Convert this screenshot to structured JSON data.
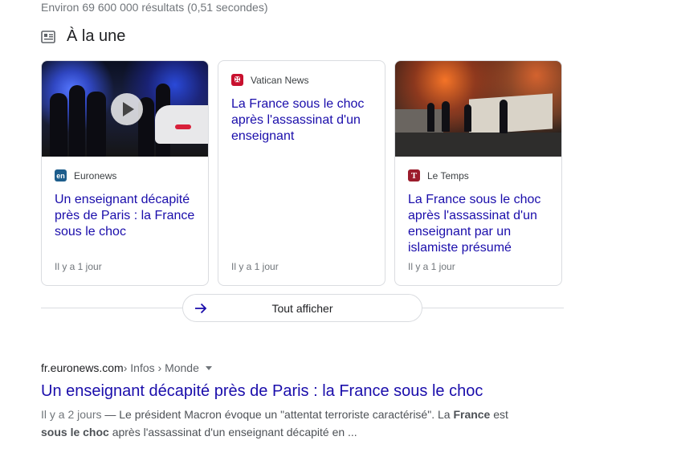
{
  "result_stats": "Environ 69 600 000 résultats (0,51 secondes)",
  "top_stories": {
    "title": "À la une",
    "icon": "news-icon",
    "cards": [
      {
        "source": "Euronews",
        "logo_text": "en",
        "logo_color": "#1d5d8c",
        "headline": "Un enseignant décapité près de Paris : la France sous le choc",
        "age": "Il y a 1 jour",
        "has_video": true
      },
      {
        "source": "Vatican News",
        "logo_text": "✠",
        "logo_color": "#c8102e",
        "headline": "La France sous le choc après l'assassinat d'un enseignant",
        "age": "Il y a 1 jour",
        "has_video": false
      },
      {
        "source": "Le Temps",
        "logo_text": "T",
        "logo_color": "#9b1c2c",
        "headline": "La France sous le choc après l'assassinat d'un enseignant par un islamiste présumé",
        "age": "Il y a 1 jour",
        "has_video": false
      }
    ],
    "show_all_label": "Tout afficher"
  },
  "result": {
    "domain": "fr.euronews.com",
    "path": " › Infos › Monde",
    "title": "Un enseignant décapité près de Paris : la France sous le choc",
    "date": "Il y a 2 jours",
    "snippet_part1": " — Le président Macron évoque un \"attentat terroriste caractérisé\". La ",
    "snippet_bold1": "France",
    "snippet_part2": " est ",
    "snippet_bold2": "sous le choc",
    "snippet_part3": " après l'assassinat d'un enseignant décapité en ..."
  },
  "colors": {
    "link": "#1a0dab",
    "muted": "#70757a",
    "border": "#dadce0"
  }
}
